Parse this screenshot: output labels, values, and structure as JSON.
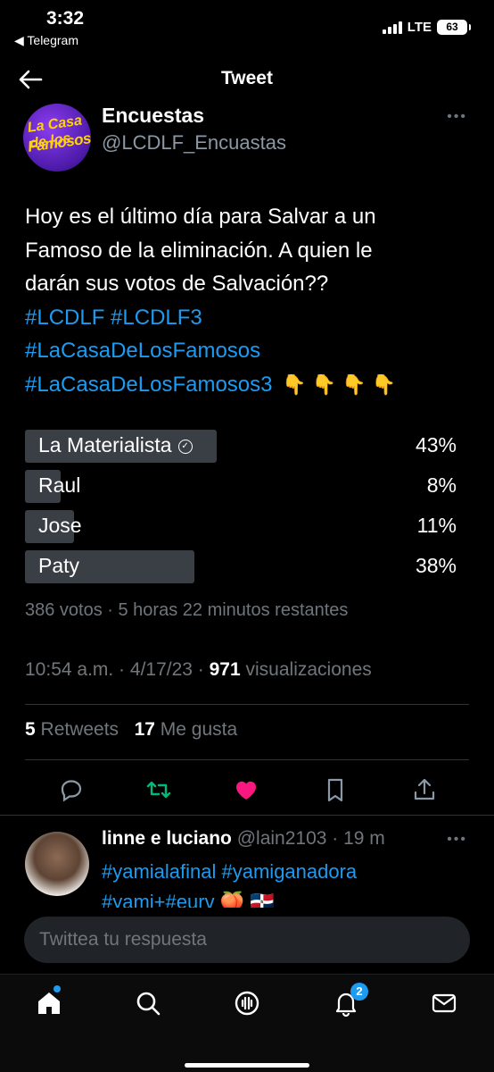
{
  "status": {
    "time": "3:32",
    "back_app": "◀ Telegram",
    "network": "LTE",
    "battery": "63"
  },
  "header": {
    "title": "Tweet"
  },
  "tweet": {
    "author_name": "Encuestas",
    "author_handle": "@LCDLF_Encuastas",
    "avatar_line1": "La Casa de los",
    "avatar_line2": "Famosos",
    "text_lines": [
      "Hoy es el último día para Salvar a un",
      "Famoso de la eliminación. A quien le",
      "darán sus votos de Salvación??"
    ],
    "hashtags_line1": [
      "#LCDLF",
      "#LCDLF3"
    ],
    "hashtag_line2": "#LaCasaDeLosFamosos",
    "hashtag_line3": "#LaCasaDeLosFamosos3",
    "emojis": "👇 👇 👇 👇"
  },
  "poll": {
    "options": [
      {
        "label": "La Materialista",
        "percent": "43%",
        "value": 43,
        "selected": true
      },
      {
        "label": "Raul",
        "percent": "8%",
        "value": 8,
        "selected": false
      },
      {
        "label": "Jose",
        "percent": "11%",
        "value": 11,
        "selected": false
      },
      {
        "label": "Paty",
        "percent": "38%",
        "value": 38,
        "selected": false
      }
    ],
    "meta": "386 votos · 5 horas 22 minutos restantes"
  },
  "timestamp": {
    "time": "10:54 a.m. · 4/17/23 · ",
    "views_count": "971",
    "views_label": " visualizaciones"
  },
  "stats": {
    "retweets_count": "5",
    "retweets_label": " Retweets",
    "likes_count": "17",
    "likes_label": " Me gusta"
  },
  "reply": {
    "name": "linne e luciano",
    "handle": " @lain2103 · 19 m",
    "line1": "#yamialafinal #yamiganadora",
    "line2": "#yami+#eurv 🍑 🇩🇴"
  },
  "compose": {
    "placeholder": "Twittea tu respuesta"
  },
  "nav": {
    "notifications_badge": "2"
  },
  "colors": {
    "accent": "#1d9bf0",
    "like": "#f91880",
    "retweet": "#00ba7c"
  }
}
